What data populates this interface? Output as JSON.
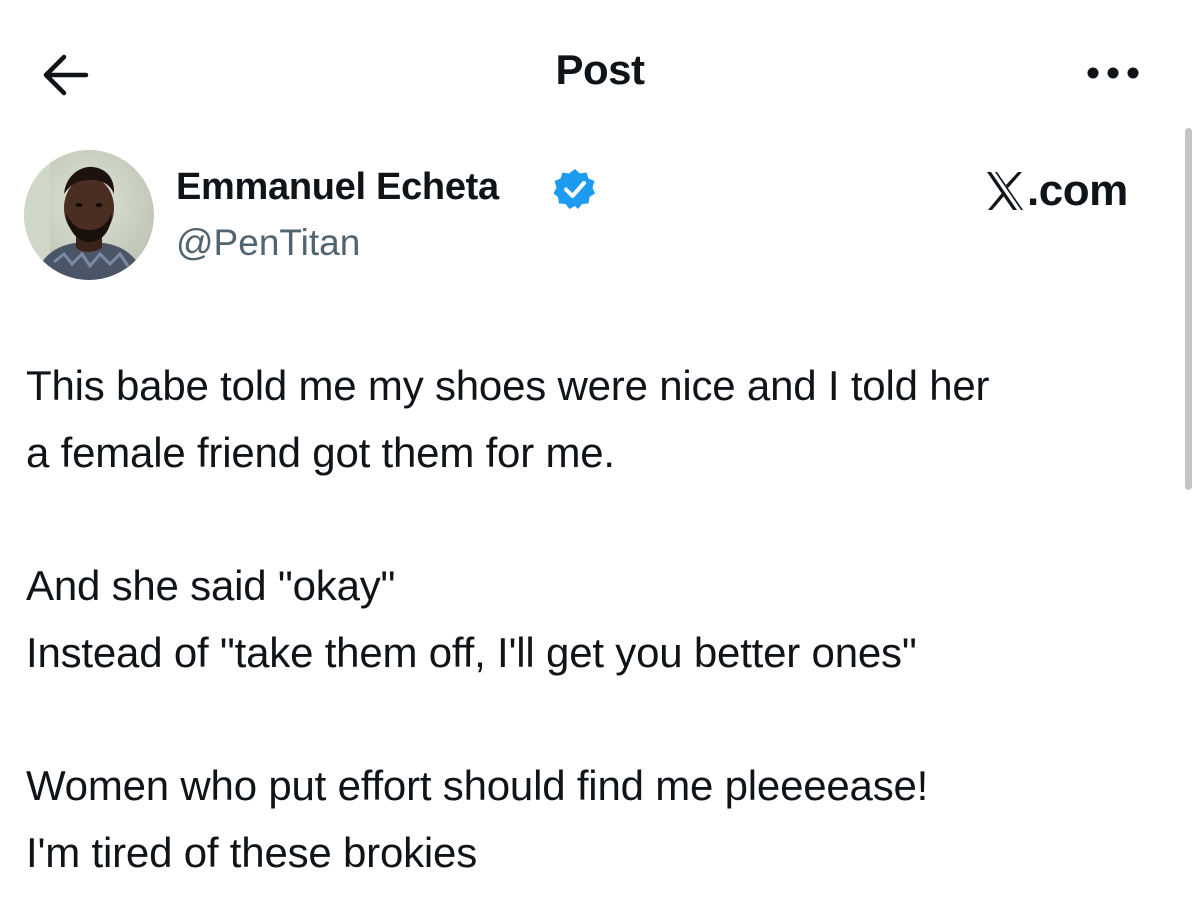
{
  "header": {
    "title": "Post",
    "back_icon": "arrow-left-icon",
    "more_icon": "more-horizontal-icon"
  },
  "author": {
    "name": "Emmanuel Echeta",
    "handle": "@PenTitan",
    "verified": true,
    "verified_color": "#1d9bf0"
  },
  "watermark": {
    "text": ".com",
    "logo": "x-logo-icon"
  },
  "post": {
    "lines": [
      "This babe told me my shoes were nice and I told her",
      "a female friend got them for me.",
      "And she said \"okay\"",
      "Instead of \"take them off, I'll get you better ones\"",
      "Women who put effort should find me pleeeease!",
      "I'm tired of these brokies"
    ]
  },
  "colors": {
    "text": "#0f1419",
    "secondary": "#536471",
    "accent": "#1d9bf0"
  }
}
